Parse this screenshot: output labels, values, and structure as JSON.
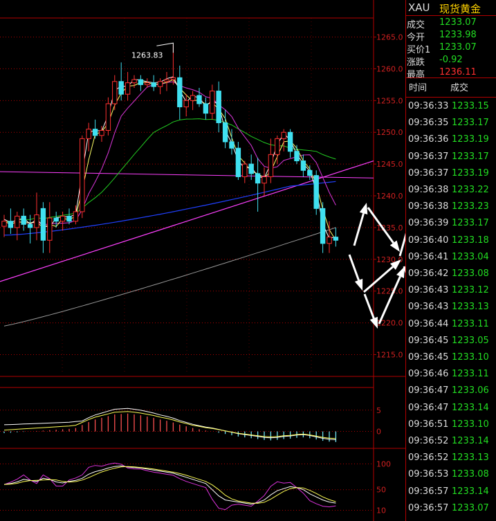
{
  "header": {
    "symbol": "XAU",
    "name": "现货黄金"
  },
  "quote": [
    {
      "label": "成交",
      "value": "1233.07",
      "color": "#22dd22"
    },
    {
      "label": "今开",
      "value": "1233.98",
      "color": "#22dd22"
    },
    {
      "label": "买价1",
      "value": "1233.07",
      "color": "#22dd22"
    },
    {
      "label": "涨跌",
      "value": "-0.92",
      "color": "#22dd22"
    },
    {
      "label": "最高",
      "value": "1236.11",
      "color": "#ff3030"
    }
  ],
  "ticks_header": {
    "time": "时间",
    "price": "成交"
  },
  "ticks": [
    {
      "time": "09:36:33",
      "price": "1233.15"
    },
    {
      "time": "09:36:35",
      "price": "1233.17"
    },
    {
      "time": "09:36:36",
      "price": "1233.19"
    },
    {
      "time": "09:36:37",
      "price": "1233.17"
    },
    {
      "time": "09:36:37",
      "price": "1233.19"
    },
    {
      "time": "09:36:38",
      "price": "1233.22"
    },
    {
      "time": "09:36:38",
      "price": "1233.23"
    },
    {
      "time": "09:36:39",
      "price": "1233.17"
    },
    {
      "time": "09:36:40",
      "price": "1233.18"
    },
    {
      "time": "09:36:41",
      "price": "1233.04"
    },
    {
      "time": "09:36:42",
      "price": "1233.08"
    },
    {
      "time": "09:36:43",
      "price": "1233.12"
    },
    {
      "time": "09:36:43",
      "price": "1233.13"
    },
    {
      "time": "09:36:44",
      "price": "1233.11"
    },
    {
      "time": "09:36:45",
      "price": "1233.05"
    },
    {
      "time": "09:36:45",
      "price": "1233.10"
    },
    {
      "time": "09:36:46",
      "price": "1233.11"
    },
    {
      "time": "09:36:47",
      "price": "1233.06"
    },
    {
      "time": "09:36:47",
      "price": "1233.14"
    },
    {
      "time": "09:36:51",
      "price": "1233.10"
    },
    {
      "time": "09:36:52",
      "price": "1233.14"
    },
    {
      "time": "09:36:52",
      "price": "1233.13"
    },
    {
      "time": "09:36:53",
      "price": "1233.08"
    },
    {
      "time": "09:36:57",
      "price": "1233.14"
    },
    {
      "time": "09:36:57",
      "price": "1233.07"
    }
  ],
  "chart_data": [
    {
      "type": "candlestick",
      "ylim": [
        1212,
        1268
      ],
      "yticks": [
        "1215.0",
        "1220.0",
        "1225.0",
        "1230.0",
        "1235.0",
        "1240.0",
        "1245.0",
        "1250.0",
        "1255.0",
        "1260.0",
        "1265.0"
      ],
      "annotation": {
        "text": "1263.83",
        "value": 1263.83
      },
      "up_color": "#ff3030",
      "down_color": "#40e0f0",
      "candles": [
        {
          "o": 1235.2,
          "h": 1237.0,
          "l": 1233.5,
          "c": 1236.0
        },
        {
          "o": 1236.0,
          "h": 1238.0,
          "l": 1234.0,
          "c": 1235.0
        },
        {
          "o": 1235.0,
          "h": 1237.5,
          "l": 1233.0,
          "c": 1236.8
        },
        {
          "o": 1236.8,
          "h": 1238.0,
          "l": 1234.5,
          "c": 1235.5
        },
        {
          "o": 1235.5,
          "h": 1237.0,
          "l": 1232.5,
          "c": 1235.0
        },
        {
          "o": 1235.0,
          "h": 1240.5,
          "l": 1233.0,
          "c": 1237.0
        },
        {
          "o": 1238.0,
          "h": 1239.0,
          "l": 1231.0,
          "c": 1233.0
        },
        {
          "o": 1233.0,
          "h": 1239.0,
          "l": 1231.0,
          "c": 1236.5
        },
        {
          "o": 1236.5,
          "h": 1237.5,
          "l": 1235.0,
          "c": 1236.0
        },
        {
          "o": 1236.0,
          "h": 1237.5,
          "l": 1234.5,
          "c": 1236.8
        },
        {
          "o": 1236.8,
          "h": 1238.0,
          "l": 1235.5,
          "c": 1236.0
        },
        {
          "o": 1236.0,
          "h": 1238.5,
          "l": 1235.5,
          "c": 1237.5
        },
        {
          "o": 1237.5,
          "h": 1249.5,
          "l": 1236.5,
          "c": 1249.0
        },
        {
          "o": 1249.0,
          "h": 1251.5,
          "l": 1247.0,
          "c": 1250.5
        },
        {
          "o": 1250.5,
          "h": 1252.0,
          "l": 1249.0,
          "c": 1249.5
        },
        {
          "o": 1249.5,
          "h": 1251.0,
          "l": 1248.5,
          "c": 1250.3
        },
        {
          "o": 1250.3,
          "h": 1255.5,
          "l": 1249.5,
          "c": 1254.5
        },
        {
          "o": 1254.5,
          "h": 1259.0,
          "l": 1253.5,
          "c": 1258.0
        },
        {
          "o": 1258.0,
          "h": 1261.0,
          "l": 1255.0,
          "c": 1256.0
        },
        {
          "o": 1256.0,
          "h": 1259.5,
          "l": 1255.0,
          "c": 1257.8
        },
        {
          "o": 1257.8,
          "h": 1259.0,
          "l": 1257.0,
          "c": 1258.3
        },
        {
          "o": 1258.3,
          "h": 1259.0,
          "l": 1256.5,
          "c": 1257.5
        },
        {
          "o": 1257.5,
          "h": 1258.5,
          "l": 1257.0,
          "c": 1257.8
        },
        {
          "o": 1257.8,
          "h": 1259.0,
          "l": 1256.5,
          "c": 1257.2
        },
        {
          "o": 1257.2,
          "h": 1258.5,
          "l": 1256.0,
          "c": 1258.0
        },
        {
          "o": 1258.0,
          "h": 1259.5,
          "l": 1256.5,
          "c": 1258.3
        },
        {
          "o": 1258.3,
          "h": 1263.8,
          "l": 1257.5,
          "c": 1258.6
        },
        {
          "o": 1258.6,
          "h": 1260.5,
          "l": 1252.0,
          "c": 1254.0
        },
        {
          "o": 1254.0,
          "h": 1256.0,
          "l": 1252.5,
          "c": 1255.0
        },
        {
          "o": 1255.0,
          "h": 1256.5,
          "l": 1253.5,
          "c": 1255.8
        },
        {
          "o": 1255.8,
          "h": 1257.0,
          "l": 1254.0,
          "c": 1254.5
        },
        {
          "o": 1254.5,
          "h": 1255.5,
          "l": 1252.0,
          "c": 1253.0
        },
        {
          "o": 1253.0,
          "h": 1257.5,
          "l": 1252.0,
          "c": 1256.5
        },
        {
          "o": 1256.5,
          "h": 1258.0,
          "l": 1250.0,
          "c": 1251.5
        },
        {
          "o": 1251.5,
          "h": 1253.5,
          "l": 1247.5,
          "c": 1248.5
        },
        {
          "o": 1248.5,
          "h": 1250.5,
          "l": 1246.5,
          "c": 1247.5
        },
        {
          "o": 1247.5,
          "h": 1248.5,
          "l": 1242.5,
          "c": 1243.0
        },
        {
          "o": 1243.0,
          "h": 1245.5,
          "l": 1242.0,
          "c": 1245.0
        },
        {
          "o": 1245.0,
          "h": 1246.5,
          "l": 1242.5,
          "c": 1243.5
        },
        {
          "o": 1243.5,
          "h": 1246.0,
          "l": 1237.5,
          "c": 1242.0
        },
        {
          "o": 1242.0,
          "h": 1244.5,
          "l": 1240.0,
          "c": 1243.0
        },
        {
          "o": 1243.0,
          "h": 1249.0,
          "l": 1242.0,
          "c": 1246.5
        },
        {
          "o": 1246.5,
          "h": 1249.5,
          "l": 1245.0,
          "c": 1249.0
        },
        {
          "o": 1249.0,
          "h": 1250.5,
          "l": 1247.0,
          "c": 1250.0
        },
        {
          "o": 1250.0,
          "h": 1250.5,
          "l": 1246.0,
          "c": 1247.0
        },
        {
          "o": 1247.0,
          "h": 1248.0,
          "l": 1245.0,
          "c": 1245.5
        },
        {
          "o": 1245.5,
          "h": 1246.5,
          "l": 1243.0,
          "c": 1244.0
        },
        {
          "o": 1244.0,
          "h": 1244.8,
          "l": 1242.5,
          "c": 1243.2
        },
        {
          "o": 1243.2,
          "h": 1244.0,
          "l": 1237.0,
          "c": 1238.0
        },
        {
          "o": 1238.0,
          "h": 1239.0,
          "l": 1231.0,
          "c": 1232.5
        },
        {
          "o": 1232.5,
          "h": 1236.0,
          "l": 1231.0,
          "c": 1233.5
        },
        {
          "o": 1233.5,
          "h": 1235.0,
          "l": 1232.0,
          "c": 1233.0
        }
      ]
    },
    {
      "type": "line",
      "ylim": [
        -3,
        10
      ],
      "yticks": [
        "0",
        "5"
      ],
      "bars": [
        -0.4,
        -0.3,
        -0.2,
        -0.1,
        0,
        0.1,
        0.2,
        0.3,
        0.4,
        0.5,
        0.6,
        0.8,
        1.5,
        2.2,
        2.8,
        3.2,
        3.6,
        4.0,
        4.1,
        4.2,
        4.0,
        3.8,
        3.5,
        3.2,
        2.8,
        2.5,
        2.1,
        1.6,
        1.2,
        0.8,
        0.5,
        0.2,
        0,
        -0.3,
        -0.6,
        -0.9,
        -1.2,
        -1.4,
        -1.6,
        -1.8,
        -2.0,
        -2.1,
        -2.0,
        -1.8,
        -1.7,
        -1.5,
        -1.4,
        -1.6,
        -1.9,
        -2.2,
        -2.4,
        -2.5
      ]
    },
    {
      "type": "line",
      "ylim": [
        0,
        110
      ],
      "yticks": [
        "10",
        "50",
        "100"
      ]
    }
  ]
}
